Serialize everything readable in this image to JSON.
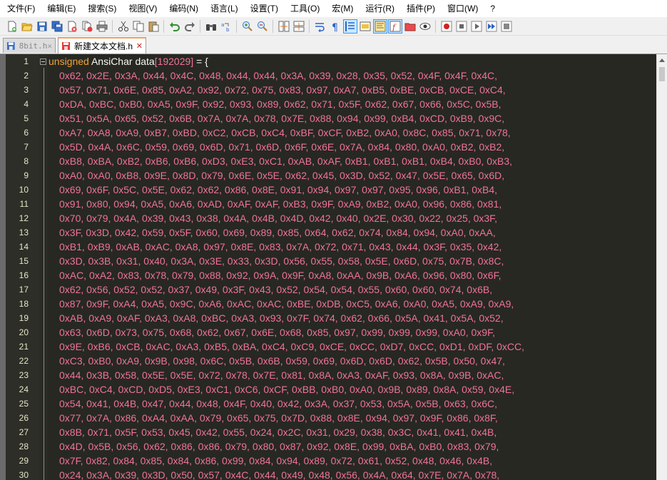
{
  "menu": [
    "文件(F)",
    "编辑(E)",
    "搜索(S)",
    "视图(V)",
    "编码(N)",
    "语言(L)",
    "设置(T)",
    "工具(O)",
    "宏(M)",
    "运行(R)",
    "插件(P)",
    "窗口(W)",
    "?"
  ],
  "tabs": [
    {
      "label": "8bit.h",
      "close": "✕"
    },
    {
      "label": "新建文本文档.h",
      "close": "✕"
    }
  ],
  "code": {
    "decl_keyword": "unsigned",
    "decl_type": "AnsiChar",
    "decl_name": "data",
    "decl_open_bracket": "[",
    "decl_size": "192029",
    "decl_close_bracket": "]",
    "decl_assign": " = {",
    "line_numbers": [
      "1",
      "2",
      "3",
      "4",
      "5",
      "6",
      "7",
      "8",
      "9",
      "10",
      "11",
      "12",
      "13",
      "14",
      "15",
      "16",
      "17",
      "18",
      "19",
      "20",
      "21",
      "22",
      "23",
      "24",
      "25",
      "26",
      "27",
      "28",
      "29",
      "30"
    ],
    "data_lines": [
      "0x62, 0x2E, 0x3A, 0x44, 0x4C, 0x48, 0x44, 0x44, 0x3A, 0x39, 0x28, 0x35, 0x52, 0x4F, 0x4F, 0x4C,",
      "0x57, 0x71, 0x6E, 0x85, 0xA2, 0x92, 0x72, 0x75, 0x83, 0x97, 0xA7, 0xB5, 0xBE, 0xCB, 0xCE, 0xC4,",
      "0xDA, 0xBC, 0xB0, 0xA5, 0x9F, 0x92, 0x93, 0x89, 0x62, 0x71, 0x5F, 0x62, 0x67, 0x66, 0x5C, 0x5B,",
      "0x51, 0x5A, 0x65, 0x52, 0x6B, 0x7A, 0x7A, 0x78, 0x7E, 0x88, 0x94, 0x99, 0xB4, 0xCD, 0xB9, 0x9C,",
      "0xA7, 0xA8, 0xA9, 0xB7, 0xBD, 0xC2, 0xCB, 0xC4, 0xBF, 0xCF, 0xB2, 0xA0, 0x8C, 0x85, 0x71, 0x78,",
      "0x5D, 0x4A, 0x6C, 0x59, 0x69, 0x6D, 0x71, 0x6D, 0x6F, 0x6E, 0x7A, 0x84, 0x80, 0xA0, 0xB2, 0xB2,",
      "0xB8, 0xBA, 0xB2, 0xB6, 0xB6, 0xD3, 0xE3, 0xC1, 0xAB, 0xAF, 0xB1, 0xB1, 0xB1, 0xB4, 0xB0, 0xB3,",
      "0xA0, 0xA0, 0xB8, 0x9E, 0x8D, 0x79, 0x6E, 0x5E, 0x62, 0x45, 0x3D, 0x52, 0x47, 0x5E, 0x65, 0x6D,",
      "0x69, 0x6F, 0x5C, 0x5E, 0x62, 0x62, 0x86, 0x8E, 0x91, 0x94, 0x97, 0x97, 0x95, 0x96, 0xB1, 0xB4,",
      "0x91, 0x80, 0x94, 0xA5, 0xA6, 0xAD, 0xAF, 0xAF, 0xB3, 0x9F, 0xA9, 0xB2, 0xA0, 0x96, 0x86, 0x81,",
      "0x70, 0x79, 0x4A, 0x39, 0x43, 0x38, 0x4A, 0x4B, 0x4D, 0x42, 0x40, 0x2E, 0x30, 0x22, 0x25, 0x3F,",
      "0x3F, 0x3D, 0x42, 0x59, 0x5F, 0x60, 0x69, 0x89, 0x85, 0x64, 0x62, 0x74, 0x84, 0x94, 0xA0, 0xAA,",
      "0xB1, 0xB9, 0xAB, 0xAC, 0xA8, 0x97, 0x8E, 0x83, 0x7A, 0x72, 0x71, 0x43, 0x44, 0x3F, 0x35, 0x42,",
      "0x3D, 0x3B, 0x31, 0x40, 0x3A, 0x3E, 0x33, 0x3D, 0x56, 0x55, 0x58, 0x5E, 0x6D, 0x75, 0x7B, 0x8C,",
      "0xAC, 0xA2, 0x83, 0x78, 0x79, 0x88, 0x92, 0x9A, 0x9F, 0xA8, 0xAA, 0x9B, 0xA6, 0x96, 0x80, 0x6F,",
      "0x62, 0x56, 0x52, 0x52, 0x37, 0x49, 0x3F, 0x43, 0x52, 0x54, 0x54, 0x55, 0x60, 0x60, 0x74, 0x6B,",
      "0x87, 0x9F, 0xA4, 0xA5, 0x9C, 0xA6, 0xAC, 0xAC, 0xBE, 0xDB, 0xC5, 0xA6, 0xA0, 0xA5, 0xA9, 0xA9,",
      "0xAB, 0xA9, 0xAF, 0xA3, 0xA8, 0xBC, 0xA3, 0x93, 0x7F, 0x74, 0x62, 0x66, 0x5A, 0x41, 0x5A, 0x52,",
      "0x63, 0x6D, 0x73, 0x75, 0x68, 0x62, 0x67, 0x6E, 0x68, 0x85, 0x97, 0x99, 0x99, 0x99, 0xA0, 0x9F,",
      "0x9E, 0xB6, 0xCB, 0xAC, 0xA3, 0xB5, 0xBA, 0xC4, 0xC9, 0xCE, 0xCC, 0xD7, 0xCC, 0xD1, 0xDF, 0xCC,",
      "0xC3, 0xB0, 0xA9, 0x9B, 0x98, 0x6C, 0x5B, 0x6B, 0x59, 0x69, 0x6D, 0x6D, 0x62, 0x5B, 0x50, 0x47,",
      "0x44, 0x3B, 0x58, 0x5E, 0x5E, 0x72, 0x78, 0x7E, 0x81, 0x8A, 0xA3, 0xAF, 0x93, 0x8A, 0x9B, 0xAC,",
      "0xBC, 0xC4, 0xCD, 0xD5, 0xE3, 0xC1, 0xC6, 0xCF, 0xBB, 0xB0, 0xA0, 0x9B, 0x89, 0x8A, 0x59, 0x4E,",
      "0x54, 0x41, 0x4B, 0x47, 0x44, 0x48, 0x4F, 0x40, 0x42, 0x3A, 0x37, 0x53, 0x5A, 0x5B, 0x63, 0x6C,",
      "0x77, 0x7A, 0x86, 0xA4, 0xAA, 0x79, 0x65, 0x75, 0x7D, 0x88, 0x8E, 0x94, 0x97, 0x9F, 0x86, 0x8F,",
      "0x8B, 0x71, 0x5F, 0x53, 0x45, 0x42, 0x55, 0x24, 0x2C, 0x31, 0x29, 0x38, 0x3C, 0x41, 0x41, 0x4B,",
      "0x4D, 0x5B, 0x56, 0x62, 0x86, 0x86, 0x79, 0x80, 0x87, 0x92, 0x8E, 0x99, 0xBA, 0xB0, 0x83, 0x79,",
      "0x7F, 0x82, 0x84, 0x85, 0x84, 0x86, 0x99, 0x84, 0x94, 0x89, 0x72, 0x61, 0x52, 0x48, 0x46, 0x4B,",
      "0x24, 0x3A, 0x39, 0x3D, 0x50, 0x57, 0x4C, 0x44, 0x49, 0x48, 0x56, 0x4A, 0x64, 0x7E, 0x7A, 0x78,"
    ]
  },
  "colors": {
    "editor_bg": "#272822",
    "keyword": "#f0a33a",
    "identifier": "#f8f8f2",
    "number": "#f0729b",
    "line_number": "#e6e6c8"
  }
}
